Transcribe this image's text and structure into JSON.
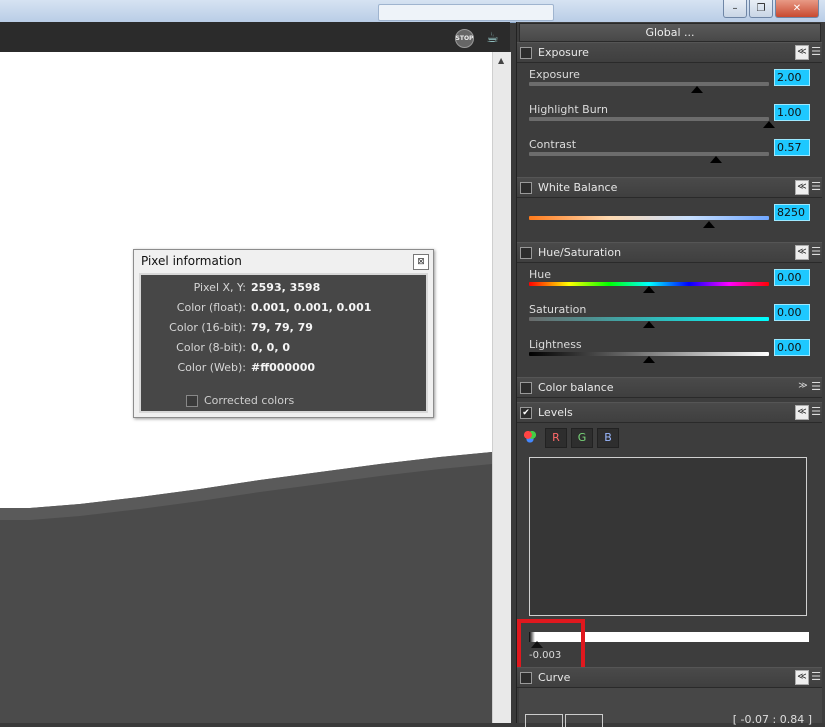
{
  "viewer": {
    "toolbar": {
      "stop_icon": "STOP",
      "teapot_icon": "☕"
    }
  },
  "pixel_info": {
    "title": "Pixel information",
    "close_icon": "⊠",
    "rows": [
      {
        "label": "Pixel X, Y:",
        "value": "2593, 3598"
      },
      {
        "label": "Color (float):",
        "value": "0.001, 0.001, 0.001"
      },
      {
        "label": "Color (16-bit):",
        "value": "79, 79, 79"
      },
      {
        "label": "Color (8-bit):",
        "value": "0, 0, 0"
      },
      {
        "label": "Color (Web):",
        "value": "#ff000000"
      }
    ],
    "corrected_colors_label": "Corrected colors"
  },
  "panel": {
    "global_label": "Global ...",
    "exposure": {
      "title": "Exposure",
      "exposure_label": "Exposure",
      "exposure_value": "2.00",
      "exposure_level": 0.7,
      "burn_label": "Highlight Burn",
      "burn_value": "1.00",
      "burn_level": 1.0,
      "contrast_label": "Contrast",
      "contrast_value": "0.57",
      "contrast_level": 0.78
    },
    "white_balance": {
      "title": "White Balance",
      "value": "8250",
      "level": 0.75
    },
    "hue_saturation": {
      "title": "Hue/Saturation",
      "hue_label": "Hue",
      "hue_value": "0.00",
      "hue_level": 0.5,
      "saturation_label": "Saturation",
      "saturation_value": "0.00",
      "saturation_level": 0.5,
      "lightness_label": "Lightness",
      "lightness_value": "0.00",
      "lightness_level": 0.5
    },
    "color_balance": {
      "title": "Color balance"
    },
    "levels": {
      "title": "Levels",
      "checked": "✔",
      "channels": [
        "R",
        "G",
        "B"
      ],
      "range_label": "-0.003"
    },
    "curve": {
      "title": "Curve",
      "range": "[ -0.07 : 0.84 ]"
    }
  },
  "colors": {
    "value_box": "#1ec8ff",
    "highlight": "#e0181e"
  }
}
